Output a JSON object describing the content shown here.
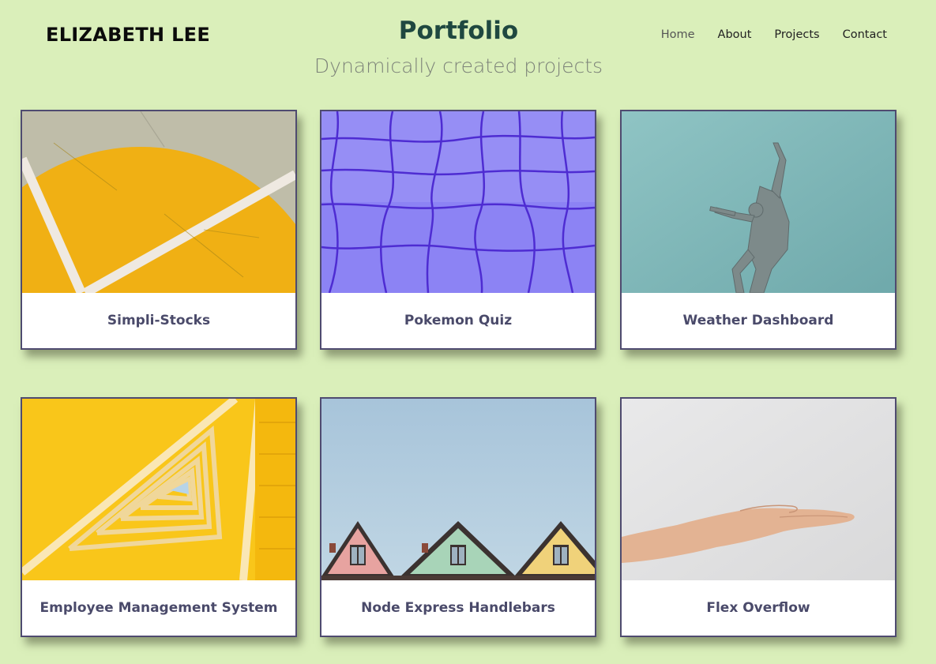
{
  "header": {
    "brand": "ELIZABETH LEE",
    "title": "Portfolio",
    "subtitle": "Dynamically created projects"
  },
  "nav": {
    "items": [
      {
        "label": "Home"
      },
      {
        "label": "About"
      },
      {
        "label": "Projects"
      },
      {
        "label": "Contact"
      }
    ]
  },
  "projects": [
    {
      "name": "Simpli-Stocks",
      "image": "yellow-court-photo"
    },
    {
      "name": "Pokemon Quiz",
      "image": "purple-pool-tiles-photo"
    },
    {
      "name": "Weather Dashboard",
      "image": "statue-sky-photo"
    },
    {
      "name": "Employee Management System",
      "image": "yellow-stairwell-photo"
    },
    {
      "name": "Node Express Handlebars",
      "image": "colorful-rooftops-photo"
    },
    {
      "name": "Flex Overflow",
      "image": "open-hand-photo"
    }
  ],
  "colors": {
    "background": "#daefba",
    "title": "#1f4840",
    "card_border": "#4f4b70",
    "card_label": "#4a4a6a"
  }
}
